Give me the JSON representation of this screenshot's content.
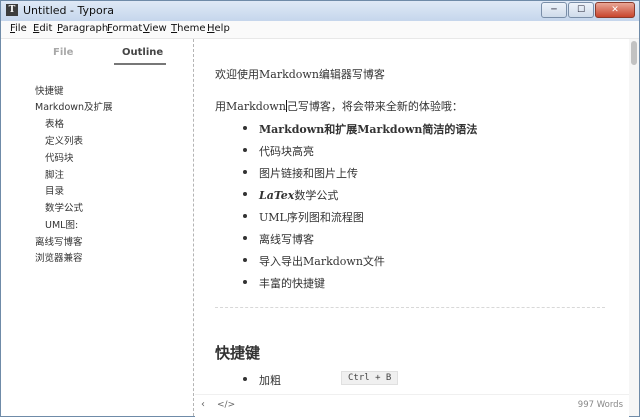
{
  "window": {
    "app_icon": "T",
    "title": "Untitled - Typora",
    "controls": [
      "minimize-icon",
      "maximize-icon",
      "close-icon"
    ]
  },
  "menu": [
    "File",
    "Edit",
    "Paragraph",
    "Format",
    "View",
    "Theme",
    "Help"
  ],
  "sidebar": {
    "tabs": {
      "file": "File",
      "outline": "Outline"
    },
    "toc": [
      "快捷键",
      "Markdown及扩展",
      "表格",
      "定义列表",
      "代码块",
      "脚注",
      "目录",
      "数学公式",
      "UML图:",
      "离线写博客",
      "浏览器兼容"
    ]
  },
  "content": {
    "intro": "欢迎使用Markdown编辑器写博客",
    "lead_before_caret": "用Markdown",
    "lead_after_caret": "己写博客，将会带来全新的体验哦：",
    "bullets": [
      "Markdown和扩展Markdown简洁的语法",
      "代码块高亮",
      "图片链接和图片上传",
      "LaTex",
      "数学公式",
      "UML序列图和流程图",
      "离线写博客",
      "导入导出Markdown文件",
      "丰富的快捷键"
    ],
    "heading": "快捷键",
    "shortcut_label": "加粗",
    "shortcut_code": "Ctrl + B"
  },
  "status": {
    "toggle_sidebar": "‹",
    "source_mode": "</>",
    "word_count": "997 Words"
  }
}
